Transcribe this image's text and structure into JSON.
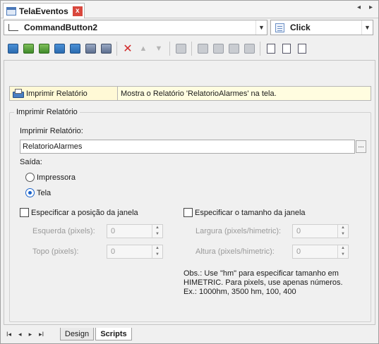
{
  "window": {
    "tab_title": "TelaEventos",
    "close_glyph": "x",
    "nav_left": "◂",
    "nav_right": "▸"
  },
  "object_combo": {
    "value": "CommandButton2",
    "icon": "command-button-icon"
  },
  "event_combo": {
    "value": "Click",
    "icon": "event-icon"
  },
  "toolbar": {
    "icons": [
      "new-script-icon",
      "insert-action-icon",
      "insert-picture-icon",
      "open-screen-icon",
      "refresh-icon",
      "settings-icon",
      "print-icon",
      "delete-icon",
      "move-up-icon",
      "move-down-icon",
      "cursor-icon",
      "binoculars-icon",
      "find-replace-icon",
      "find-next-icon",
      "spell-icon",
      "document-icon",
      "document-check-icon",
      "document-list-icon"
    ]
  },
  "action": {
    "name": "Imprimir Relatório",
    "description": "Mostra o Relatório 'RelatorioAlarmes' na tela."
  },
  "form": {
    "group_title": "Imprimir Relatório",
    "report_label": "Imprimir Relatório:",
    "report_value": "RelatorioAlarmes",
    "browse_label": "...",
    "output_label": "Saída:",
    "output_options": [
      {
        "label": "Impressora",
        "selected": false
      },
      {
        "label": "Tela",
        "selected": true
      }
    ],
    "position": {
      "check_label": "Especificar a posição da janela",
      "checked": false,
      "left_label": "Esquerda (pixels):",
      "left_value": "0",
      "top_label": "Topo (pixels):",
      "top_value": "0"
    },
    "size": {
      "check_label": "Especificar o tamanho da janela",
      "checked": false,
      "width_label": "Largura (pixels/himetric):",
      "width_value": "0",
      "height_label": "Altura (pixels/himetric):",
      "height_value": "0"
    },
    "obs_lines": [
      "Obs.: Use \"hm\" para especificar tamanho em",
      "HIMETRIC. Para pixels, use apenas números.",
      "Ex.: 1000hm, 3500 hm, 100, 400"
    ]
  },
  "bottom_tabs": {
    "first": "I◂",
    "prev": "◂",
    "next": "▸",
    "last": "▸I",
    "tabs": [
      {
        "label": "Design",
        "active": false
      },
      {
        "label": "Scripts",
        "active": true
      }
    ]
  }
}
